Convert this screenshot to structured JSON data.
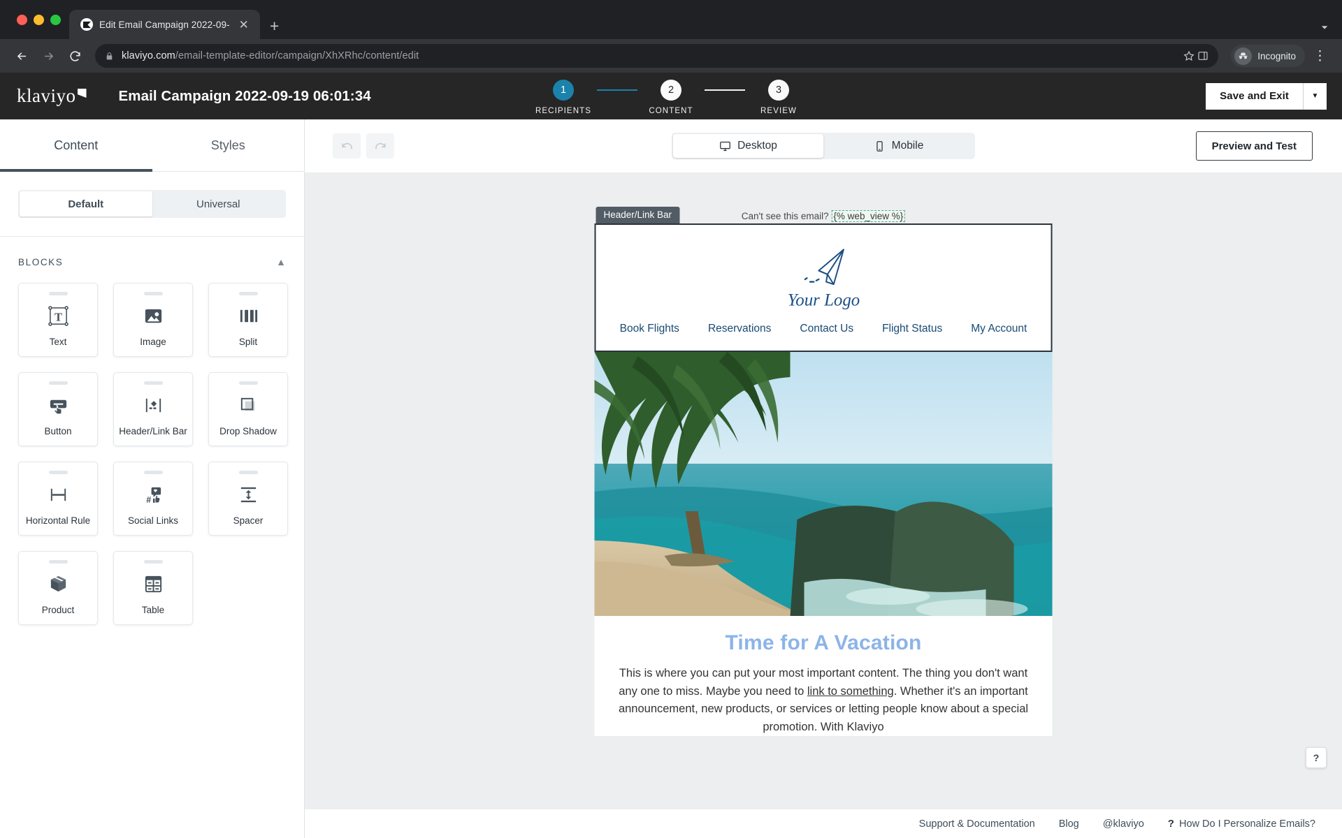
{
  "browser": {
    "tab_title": "Edit Email Campaign 2022-09-",
    "url_domain": "klaviyo.com",
    "url_path": "/email-template-editor/campaign/XhXRhc/content/edit",
    "profile_label": "Incognito"
  },
  "app_header": {
    "brand": "klaviyo",
    "campaign_title": "Email Campaign 2022-09-19 06:01:34",
    "save_label": "Save and Exit",
    "steps": [
      {
        "number": "1",
        "label": "RECIPIENTS",
        "state": "active"
      },
      {
        "number": "2",
        "label": "CONTENT",
        "state": "idle"
      },
      {
        "number": "3",
        "label": "REVIEW",
        "state": "idle"
      }
    ],
    "accent_color": "#1b82ab"
  },
  "left_panel": {
    "tabs": [
      {
        "label": "Content",
        "selected": true
      },
      {
        "label": "Styles",
        "selected": false
      }
    ],
    "segment": [
      {
        "label": "Default",
        "selected": true
      },
      {
        "label": "Universal",
        "selected": false
      }
    ],
    "blocks_header": "BLOCKS",
    "blocks": [
      {
        "label": "Text",
        "icon": "text-block-icon"
      },
      {
        "label": "Image",
        "icon": "image-block-icon"
      },
      {
        "label": "Split",
        "icon": "split-block-icon"
      },
      {
        "label": "Button",
        "icon": "button-block-icon"
      },
      {
        "label": "Header/Link Bar",
        "icon": "header-link-bar-block-icon"
      },
      {
        "label": "Drop Shadow",
        "icon": "drop-shadow-block-icon"
      },
      {
        "label": "Horizontal Rule",
        "icon": "horizontal-rule-block-icon"
      },
      {
        "label": "Social Links",
        "icon": "social-links-block-icon"
      },
      {
        "label": "Spacer",
        "icon": "spacer-block-icon"
      },
      {
        "label": "Product",
        "icon": "product-block-icon"
      },
      {
        "label": "Table",
        "icon": "table-block-icon"
      }
    ]
  },
  "canvas_toolbar": {
    "undo": "undo-icon",
    "redo": "redo-icon",
    "devices": [
      {
        "label": "Desktop",
        "selected": true
      },
      {
        "label": "Mobile",
        "selected": false
      }
    ],
    "preview_label": "Preview and Test"
  },
  "email": {
    "web_view_prefix": "Can't see this email?",
    "web_view_tag": "{% web_view %}",
    "selected_block_label": "Header/Link Bar",
    "logo_text": "Your Logo",
    "nav_links": [
      "Book Flights",
      "Reservations",
      "Contact Us",
      "Flight Status",
      "My Account"
    ],
    "heading": "Time for A Vacation",
    "body_text_1": "This is where you can put your most important content. The thing you don't want any one to miss. Maybe you need to ",
    "body_link": "link to something",
    "body_text_2": ". Whether it's an important announcement, new products, or services or letting people know about a special promotion. With Klaviyo",
    "heading_color": "#8cb4e8",
    "link_color": "#184a73",
    "hover_tools": [
      {
        "name": "duplicate-icon"
      },
      {
        "name": "favorite-icon"
      },
      {
        "name": "delete-icon"
      }
    ]
  },
  "footer": {
    "links": [
      "Support & Documentation",
      "Blog",
      "@klaviyo"
    ],
    "help_mark": "?",
    "help_label": "How Do I Personalize Emails?",
    "fab_label": "?"
  }
}
